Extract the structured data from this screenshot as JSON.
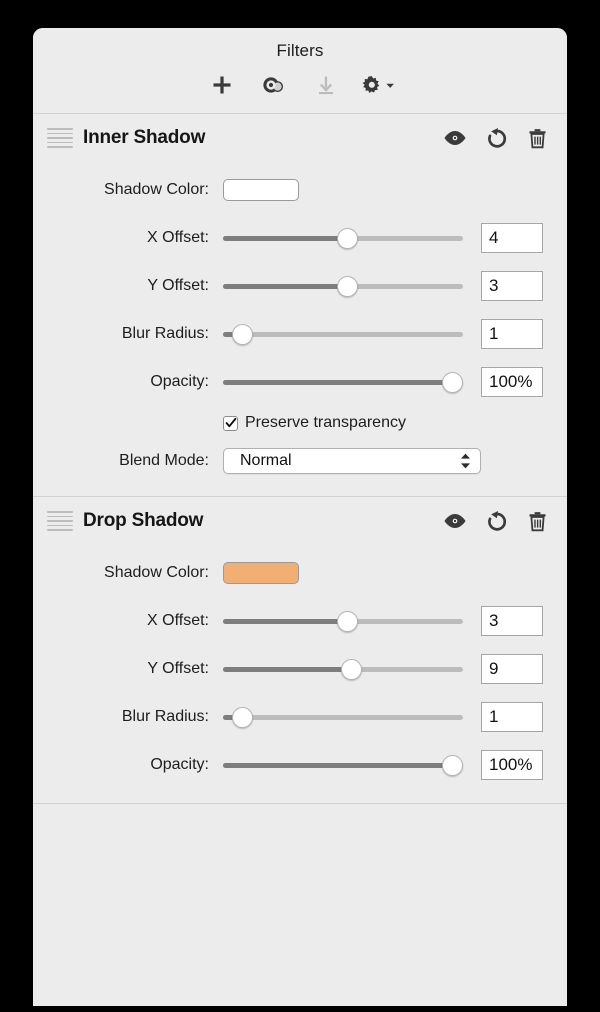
{
  "window": {
    "title": "Filters",
    "background_color": "#ececec",
    "outer_background": "#000000"
  },
  "toolbar": {
    "buttons": [
      {
        "name": "add-filter-button",
        "icon": "plus-icon",
        "label": "Add filter",
        "enabled": true
      },
      {
        "name": "merge-filter-button",
        "icon": "overlapping-circles-icon",
        "label": "Merge filters",
        "enabled": true
      },
      {
        "name": "import-filter-button",
        "icon": "download-icon",
        "label": "Import filter",
        "enabled": false
      },
      {
        "name": "filter-options-button",
        "icon": "gear-icon",
        "label": "Filter options",
        "enabled": true
      }
    ]
  },
  "filters": [
    {
      "title": "Inner Shadow",
      "header_icons": [
        {
          "name": "visibility-toggle",
          "icon": "eye-icon",
          "label": "Toggle visibility"
        },
        {
          "name": "reset-filter-button",
          "icon": "reset-arrow-icon",
          "label": "Reset filter"
        },
        {
          "name": "delete-filter-button",
          "icon": "trash-icon",
          "label": "Delete filter"
        }
      ],
      "color": {
        "label": "Shadow Color:",
        "value": "#ffffff"
      },
      "sliders": [
        {
          "label": "X Offset:",
          "value": "4",
          "percent": 52
        },
        {
          "label": "Y Offset:",
          "value": "3",
          "percent": 52
        },
        {
          "label": "Blur Radius:",
          "value": "1",
          "percent": 4
        },
        {
          "label": "Opacity:",
          "value": "100%",
          "percent": 100
        }
      ],
      "checkbox": {
        "label": "Preserve transparency",
        "checked": true
      },
      "blend_mode": {
        "label": "Blend Mode:",
        "value": "Normal"
      }
    },
    {
      "title": "Drop Shadow",
      "header_icons": [
        {
          "name": "visibility-toggle",
          "icon": "eye-icon",
          "label": "Toggle visibility"
        },
        {
          "name": "reset-filter-button",
          "icon": "reset-arrow-icon",
          "label": "Reset filter"
        },
        {
          "name": "delete-filter-button",
          "icon": "trash-icon",
          "label": "Delete filter"
        }
      ],
      "color": {
        "label": "Shadow Color:",
        "value": "#f2af73"
      },
      "sliders": [
        {
          "label": "X Offset:",
          "value": "3",
          "percent": 52
        },
        {
          "label": "Y Offset:",
          "value": "9",
          "percent": 54
        },
        {
          "label": "Blur Radius:",
          "value": "1",
          "percent": 4
        },
        {
          "label": "Opacity:",
          "value": "100%",
          "percent": 100
        }
      ]
    }
  ]
}
